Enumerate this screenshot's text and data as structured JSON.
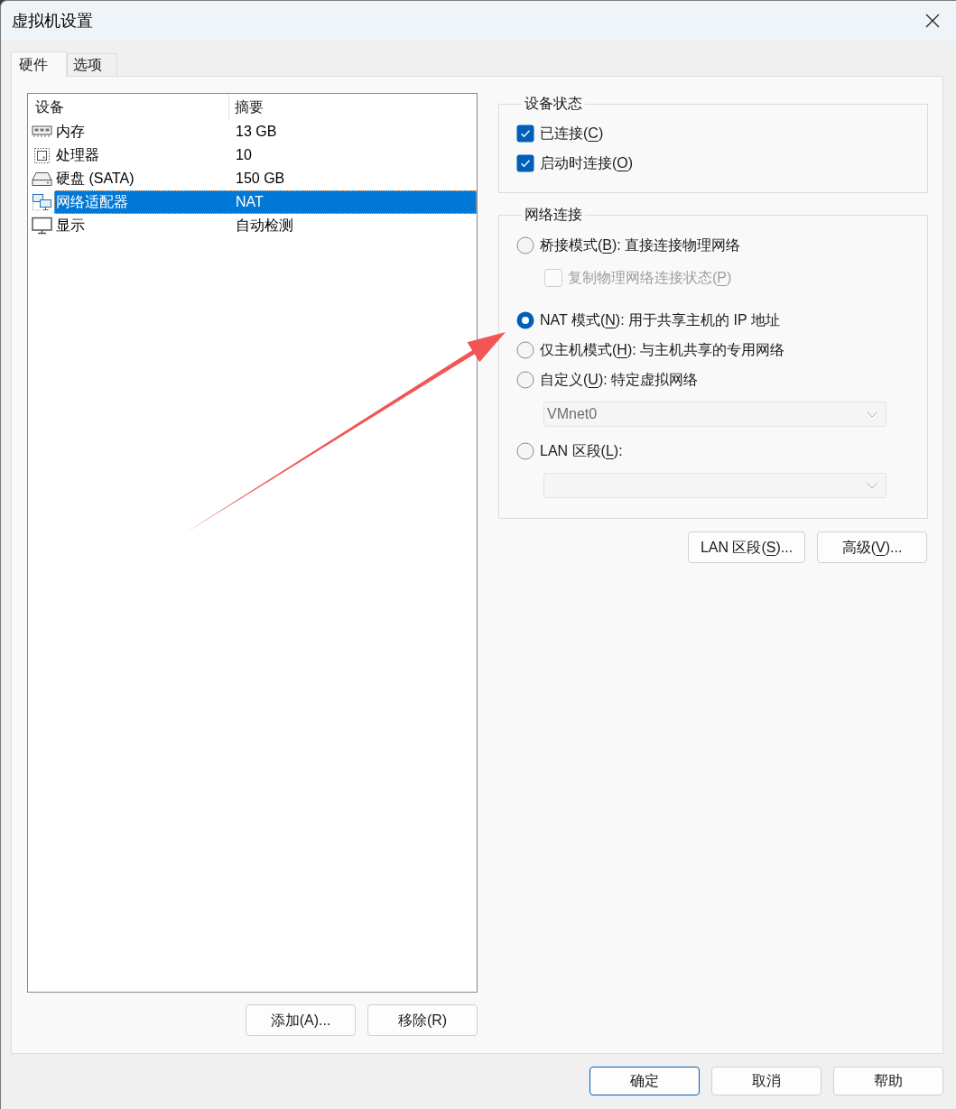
{
  "window": {
    "title": "虚拟机设置"
  },
  "tabs": [
    {
      "label": "硬件",
      "selected": true
    },
    {
      "label": "选项",
      "selected": false
    }
  ],
  "device_list": {
    "columns": [
      "设备",
      "摘要"
    ],
    "rows": [
      {
        "kind": "memory",
        "device": "内存",
        "summary": "13 GB",
        "selected": false
      },
      {
        "kind": "processor",
        "device": "处理器",
        "summary": "10",
        "selected": false
      },
      {
        "kind": "disk",
        "device": "硬盘 (SATA)",
        "summary": "150 GB",
        "selected": false
      },
      {
        "kind": "network",
        "device": "网络适配器",
        "summary": "NAT",
        "selected": true
      },
      {
        "kind": "display",
        "device": "显示",
        "summary": "自动检测",
        "selected": false
      }
    ]
  },
  "list_buttons": [
    {
      "label": "添加(A)..."
    },
    {
      "label": "移除(R)"
    }
  ],
  "device_status": {
    "title": "设备状态",
    "options": [
      {
        "label": {
          "pre": "已连接(",
          "key": "C",
          "post": ")"
        },
        "checked": true
      },
      {
        "label": {
          "pre": "启动时连接(",
          "key": "O",
          "post": ")"
        },
        "checked": true
      }
    ]
  },
  "network_connection": {
    "title": "网络连接",
    "items": [
      {
        "kind": "radio",
        "label": {
          "pre": "桥接模式(",
          "key": "B",
          "post": "): 直接连接物理网络"
        },
        "selected": false,
        "disabled": false
      },
      {
        "kind": "checkbox",
        "label": {
          "pre": "复制物理网络连接状态(",
          "key": "P",
          "post": ")"
        },
        "checked": false,
        "disabled": true
      },
      {
        "kind": "radio",
        "label": {
          "pre": "NAT 模式(",
          "key": "N",
          "post": "): 用于共享主机的 IP 地址"
        },
        "selected": true,
        "disabled": false
      },
      {
        "kind": "radio",
        "label": {
          "pre": "仅主机模式(",
          "key": "H",
          "post": "): 与主机共享的专用网络"
        },
        "selected": false,
        "disabled": false
      },
      {
        "kind": "radio",
        "label": {
          "pre": "自定义(",
          "key": "U",
          "post": "): 特定虚拟网络"
        },
        "selected": false,
        "disabled": false
      },
      {
        "kind": "dropdown",
        "value": "VMnet0",
        "disabled": true
      },
      {
        "kind": "radio",
        "label": {
          "pre": "LAN 区段(",
          "key": "L",
          "post": "):"
        },
        "selected": false,
        "disabled": false
      },
      {
        "kind": "dropdown",
        "disabled": true
      }
    ]
  },
  "network_buttons": [
    {
      "label": {
        "pre": "LAN 区段(",
        "key": "S",
        "post": ")..."
      }
    },
    {
      "label": {
        "pre": "高级(",
        "key": "V",
        "post": ")..."
      }
    }
  ],
  "dialog_buttons": [
    {
      "label": "确定",
      "default": true
    },
    {
      "label": "取消",
      "default": false
    },
    {
      "label": "帮助",
      "default": false
    }
  ]
}
